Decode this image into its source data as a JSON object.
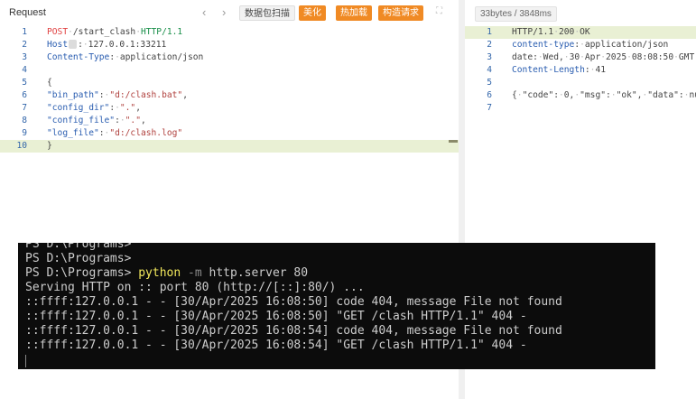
{
  "request": {
    "title": "Request",
    "nav_prev": "‹",
    "nav_next": "›",
    "buttons": {
      "scan": "数据包扫描",
      "beautify": "美化",
      "hotload": "热加载",
      "construct": "构造请求"
    },
    "lines": [
      {
        "n": "1",
        "segments": [
          [
            "k-method",
            "POST"
          ],
          [
            "k-dot",
            "·"
          ],
          [
            "k-plain",
            "/start_clash"
          ],
          [
            "k-dot",
            "·"
          ],
          [
            "k-ver",
            "HTTP/1.1"
          ]
        ]
      },
      {
        "n": "2",
        "segments": [
          [
            "k-key",
            "Host"
          ],
          [
            "caret",
            ""
          ],
          [
            "k-plain",
            ":"
          ],
          [
            "k-dot",
            "·"
          ],
          [
            "k-plain",
            "127.0.0.1:33211"
          ]
        ]
      },
      {
        "n": "3",
        "segments": [
          [
            "k-key",
            "Content-Type"
          ],
          [
            "k-plain",
            ":"
          ],
          [
            "k-dot",
            "·"
          ],
          [
            "k-plain",
            "application/json"
          ]
        ]
      },
      {
        "n": "4",
        "segments": []
      },
      {
        "n": "5",
        "segments": [
          [
            "k-plain",
            "{"
          ]
        ]
      },
      {
        "n": "6",
        "segments": [
          [
            "k-key",
            "\"bin_path\""
          ],
          [
            "k-plain",
            ":"
          ],
          [
            "k-dot",
            "·"
          ],
          [
            "k-str",
            "\"d:/clash.bat\""
          ],
          [
            "k-plain",
            ","
          ]
        ]
      },
      {
        "n": "7",
        "segments": [
          [
            "k-key",
            "\"config_dir\""
          ],
          [
            "k-plain",
            ":"
          ],
          [
            "k-dot",
            "·"
          ],
          [
            "k-str",
            "\".\""
          ],
          [
            "k-plain",
            ","
          ]
        ]
      },
      {
        "n": "8",
        "segments": [
          [
            "k-key",
            "\"config_file\""
          ],
          [
            "k-plain",
            ":"
          ],
          [
            "k-dot",
            "·"
          ],
          [
            "k-str",
            "\".\""
          ],
          [
            "k-plain",
            ","
          ]
        ]
      },
      {
        "n": "9",
        "segments": [
          [
            "k-key",
            "\"log_file\""
          ],
          [
            "k-plain",
            ":"
          ],
          [
            "k-dot",
            "·"
          ],
          [
            "k-str",
            "\"d:/clash.log\""
          ]
        ]
      },
      {
        "n": "10",
        "segments": [
          [
            "k-plain",
            "}"
          ]
        ],
        "highlight": true
      }
    ]
  },
  "response": {
    "size_badge": "33bytes / 3848ms",
    "lines": [
      {
        "n": "1",
        "segments": [
          [
            "k-plain",
            "HTTP/1.1"
          ],
          [
            "k-dot",
            "·"
          ],
          [
            "k-plain",
            "200"
          ],
          [
            "k-dot",
            "·"
          ],
          [
            "k-plain",
            "OK"
          ]
        ],
        "highlight": true
      },
      {
        "n": "2",
        "segments": [
          [
            "k-key",
            "content-type"
          ],
          [
            "k-plain",
            ":"
          ],
          [
            "k-dot",
            "·"
          ],
          [
            "k-plain",
            "application/json"
          ]
        ]
      },
      {
        "n": "3",
        "segments": [
          [
            "k-plain",
            "date:"
          ],
          [
            "k-dot",
            "·"
          ],
          [
            "k-plain",
            "Wed,"
          ],
          [
            "k-dot",
            "·"
          ],
          [
            "k-plain",
            "30"
          ],
          [
            "k-dot",
            "·"
          ],
          [
            "k-plain",
            "Apr"
          ],
          [
            "k-dot",
            "·"
          ],
          [
            "k-plain",
            "2025"
          ],
          [
            "k-dot",
            "·"
          ],
          [
            "k-plain",
            "08:08:50"
          ],
          [
            "k-dot",
            "·"
          ],
          [
            "k-plain",
            "GMT"
          ]
        ]
      },
      {
        "n": "4",
        "segments": [
          [
            "k-key",
            "Content-Length"
          ],
          [
            "k-plain",
            ":"
          ],
          [
            "k-dot",
            "·"
          ],
          [
            "k-plain",
            "41"
          ]
        ]
      },
      {
        "n": "5",
        "segments": []
      },
      {
        "n": "6",
        "segments": [
          [
            "k-plain",
            "{"
          ],
          [
            "k-dot",
            "·"
          ],
          [
            "k-plain",
            "\"code\":"
          ],
          [
            "k-dot",
            "·"
          ],
          [
            "k-plain",
            "0,"
          ],
          [
            "k-dot",
            "·"
          ],
          [
            "k-plain",
            "\"msg\":"
          ],
          [
            "k-dot",
            "·"
          ],
          [
            "k-plain",
            "\"ok\","
          ],
          [
            "k-dot",
            "·"
          ],
          [
            "k-plain",
            "\"data\":"
          ],
          [
            "k-dot",
            "·"
          ],
          [
            "k-plain",
            "nu"
          ]
        ]
      },
      {
        "n": "7",
        "segments": []
      }
    ]
  },
  "terminal": {
    "lines": [
      "PS D:\\Programs>",
      "PS D:\\Programs>",
      "PS D:\\Programs> python -m http.server 80",
      "Serving HTTP on :: port 80 (http://[::]:80/) ...",
      "::ffff:127.0.0.1 - - [30/Apr/2025 16:08:50] code 404, message File not found",
      "::ffff:127.0.0.1 - - [30/Apr/2025 16:08:50] \"GET /clash HTTP/1.1\" 404 -",
      "::ffff:127.0.0.1 - - [30/Apr/2025 16:08:54] code 404, message File not found",
      "::ffff:127.0.0.1 - - [30/Apr/2025 16:08:54] \"GET /clash HTTP/1.1\" 404 -"
    ],
    "command": {
      "prompt": "PS D:\\Programs> ",
      "program": "python",
      "flag": " -m",
      "rest": " http.server 80"
    }
  },
  "colors": {
    "accent": "#f08a24",
    "key": "#2a5db0",
    "string": "#b0413e",
    "method": "#e04040",
    "version": "#1a8f4a"
  },
  "icons": {
    "expand": "expand-icon",
    "prev": "chevron-left-icon",
    "next": "chevron-right-icon"
  }
}
